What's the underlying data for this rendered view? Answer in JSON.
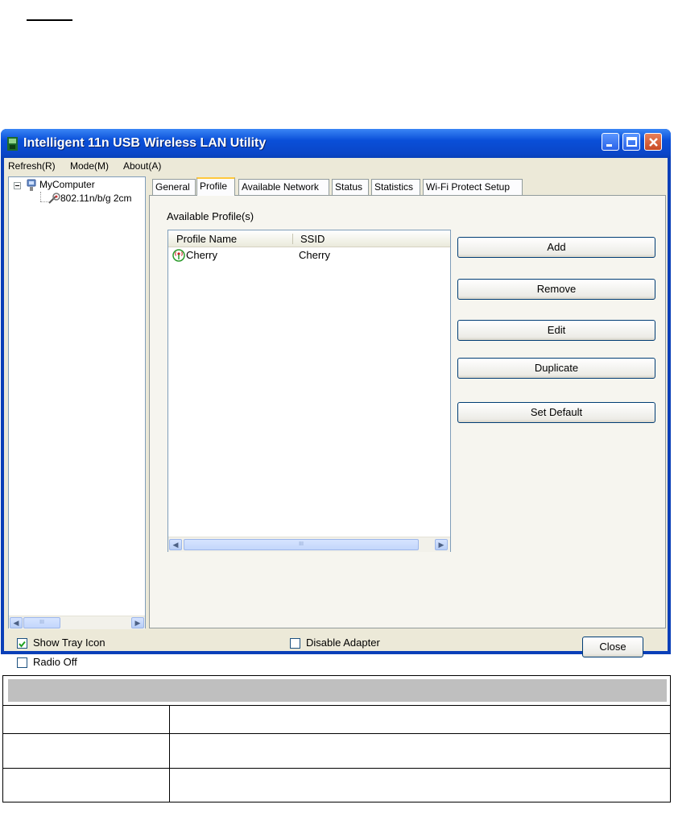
{
  "window": {
    "title": "Intelligent 11n USB Wireless LAN Utility",
    "controls": [
      "minimize-icon",
      "maximize-icon",
      "close-icon"
    ]
  },
  "menu": [
    "Refresh(R)",
    "Mode(M)",
    "About(A)"
  ],
  "tree": {
    "root": "MyComputer",
    "child": "802.11n/b/g 2cm"
  },
  "tabs": [
    {
      "label": "General",
      "active": false
    },
    {
      "label": "Profile",
      "active": true
    },
    {
      "label": "Available Network",
      "active": false
    },
    {
      "label": "Status",
      "active": false
    },
    {
      "label": "Statistics",
      "active": false
    },
    {
      "label": "Wi-Fi Protect Setup",
      "active": false
    }
  ],
  "profile": {
    "section_label": "Available Profile(s)",
    "columns": [
      "Profile Name",
      "SSID"
    ],
    "rows": [
      {
        "name": "Cherry",
        "ssid": "Cherry",
        "icon": "wireless-profile-icon"
      }
    ],
    "scroll_thumb_glyph": "III"
  },
  "actions": {
    "add": "Add",
    "remove": "Remove",
    "edit": "Edit",
    "duplicate": "Duplicate",
    "set_default": "Set Default"
  },
  "footer": {
    "show_tray_icon": {
      "label": "Show Tray Icon",
      "checked": true
    },
    "radio_off": {
      "label": "Radio Off",
      "checked": false
    },
    "disable_adapter": {
      "label": "Disable Adapter",
      "checked": false
    },
    "close": "Close"
  },
  "colors": {
    "titlebar": "#0a46c8",
    "tab_highlight": "#ffc83c",
    "dialog_bg": "#ece9d8"
  }
}
